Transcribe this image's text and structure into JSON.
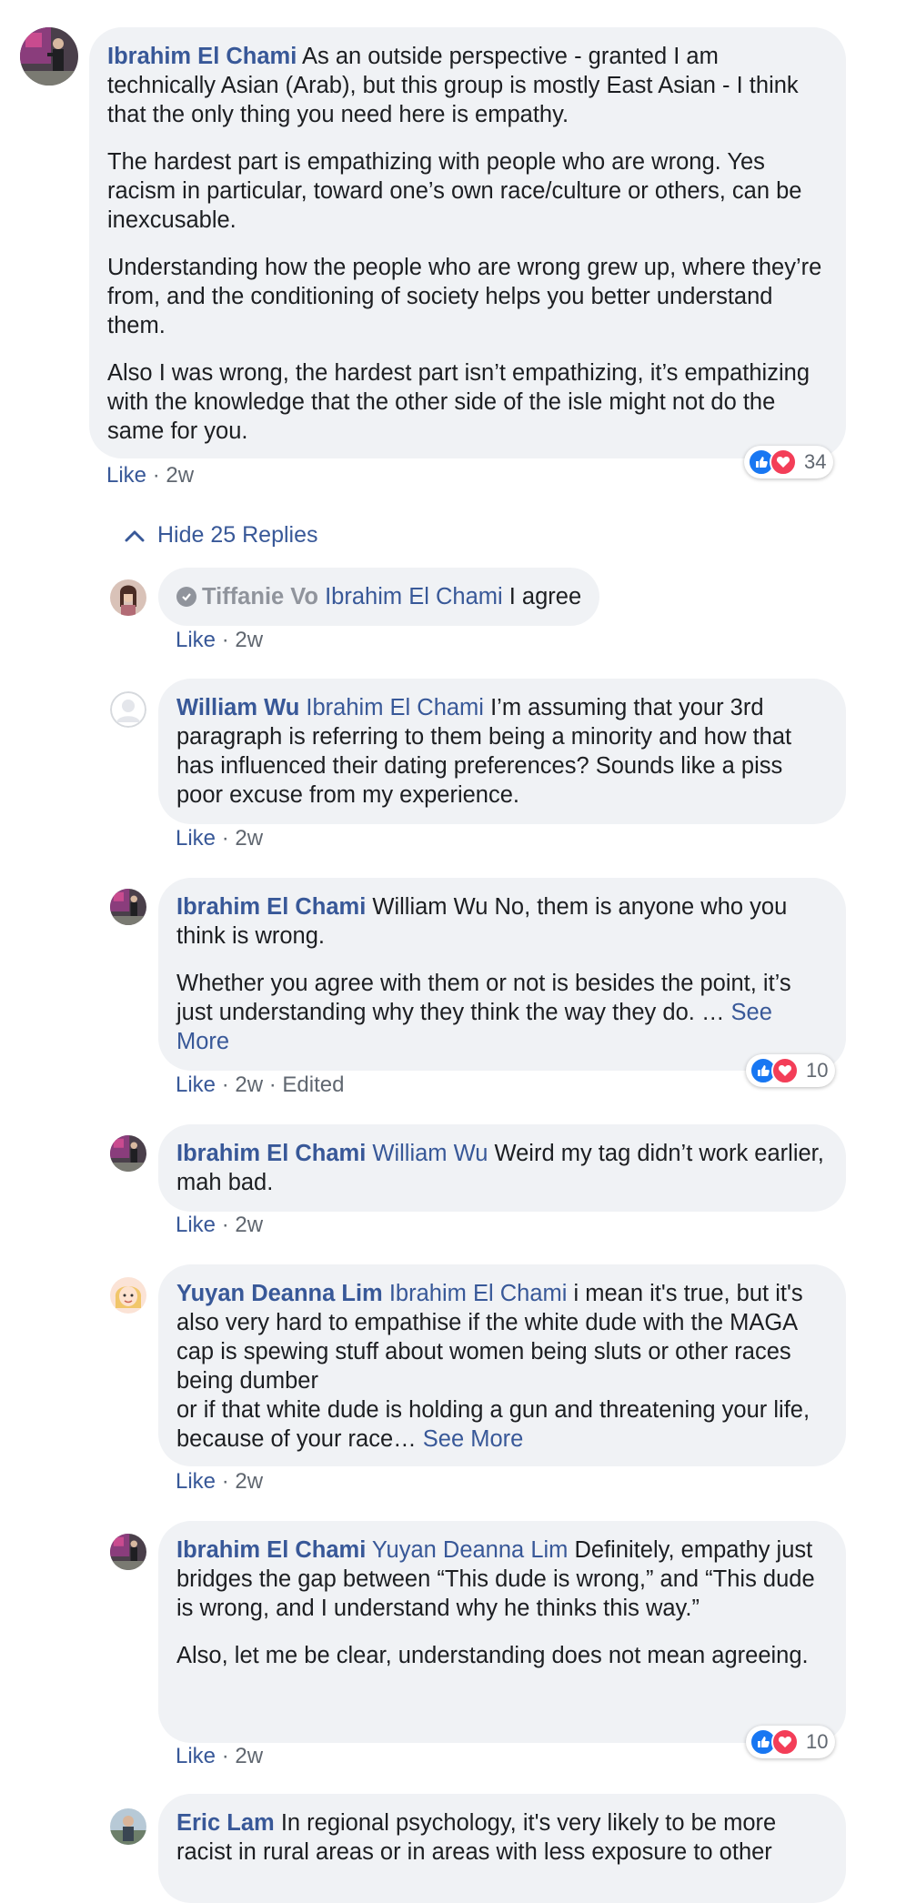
{
  "comment": {
    "author": "Ibrahim El Chami",
    "paragraphs": [
      "As an outside perspective - granted I am technically Asian (Arab), but this group is mostly East Asian - I think that the only thing you need here is empathy.",
      "The hardest part is empathizing with people who are wrong. Yes racism in particular, toward one’s own race/culture or others, can be inexcusable.",
      "Understanding how the people who are wrong grew up, where they’re from, and the conditioning of society helps you better understand them.",
      "Also I was wrong, the hardest part isn’t empathizing, it’s empathizing with the knowledge that the other side of the isle might not do the same for you."
    ],
    "like_label": "Like",
    "time": "2w",
    "reaction_count": "34"
  },
  "hide_replies_label": "Hide 25 Replies",
  "replies": [
    {
      "author": "Tiffanie Vo",
      "tag": "Ibrahim El Chami",
      "text": "I agree",
      "like_label": "Like",
      "time": "2w"
    },
    {
      "author": "William Wu",
      "tag": "Ibrahim El Chami",
      "text": "I’m assuming that your 3rd paragraph is referring to them being a minority and how that has influenced their dating preferences? Sounds like a piss poor excuse from my experience.",
      "like_label": "Like",
      "time": "2w"
    },
    {
      "author": "Ibrahim El Chami",
      "tag": "",
      "text": "William Wu No, them is anyone who you think is wrong.",
      "text2": "Whether you agree with them or not is besides the point, it’s just understanding why they think the way they do.",
      "ellipsis": "…",
      "see_more": "See More",
      "like_label": "Like",
      "time": "2w",
      "edited": "Edited",
      "reaction_count": "10"
    },
    {
      "author": "Ibrahim El Chami",
      "tag": "William Wu",
      "text": "Weird my tag didn’t work earlier, mah bad.",
      "like_label": "Like",
      "time": "2w"
    },
    {
      "author": "Yuyan Deanna Lim",
      "tag": "Ibrahim El Chami",
      "text": "i mean it's true, but it's also very hard to empathise if the white dude with the MAGA cap is spewing stuff about women being sluts or other races being dumber",
      "text2": "or if that white dude is holding a gun and threatening your life, because of your race…",
      "see_more": "See More",
      "like_label": "Like",
      "time": "2w"
    },
    {
      "author": "Ibrahim El Chami",
      "tag": "Yuyan Deanna Lim",
      "text": "Definitely, empathy just bridges the gap between “This dude is wrong,” and “This dude is wrong, and I understand why he thinks this way.”",
      "text2": "Also, let me be clear, understanding does not mean agreeing.",
      "like_label": "Like",
      "time": "2w",
      "reaction_count": "10"
    },
    {
      "author": "Eric Lam",
      "tag": "",
      "text": "In regional psychology, it's very likely to be more racist in rural areas or in areas with less exposure to other"
    }
  ],
  "icons": {
    "reaction_like": "thumbs-up-icon",
    "reaction_love": "heart-icon",
    "hide_replies": "chevron-up-icon",
    "verified": "verified-check-icon"
  },
  "colors": {
    "link": "#385898",
    "bubble": "#f0f2f5",
    "like_reaction": "#1877f2",
    "love_reaction": "#f33e58"
  }
}
